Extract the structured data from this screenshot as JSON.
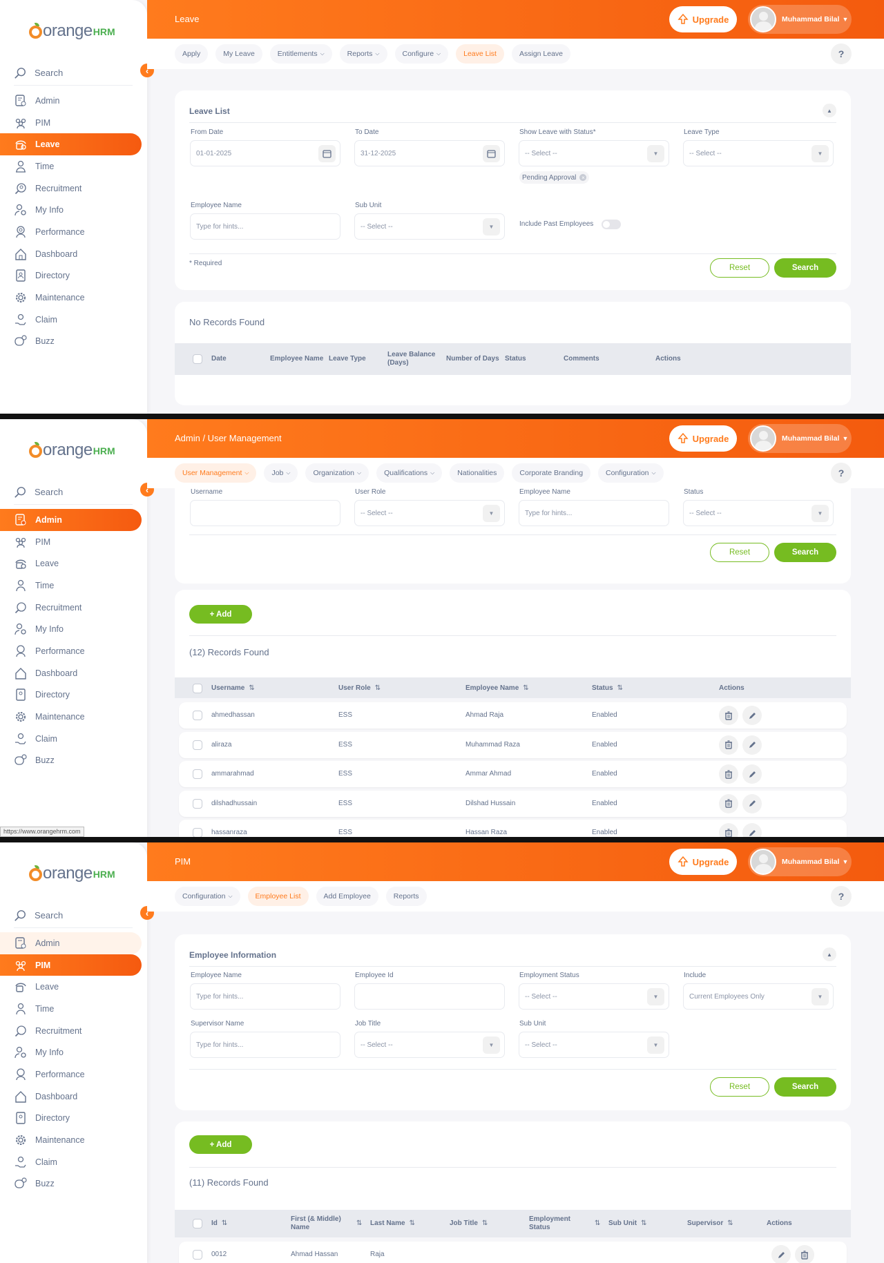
{
  "app": {
    "logo_word": "orange",
    "logo_suffix": "HRM",
    "search_label": "Search",
    "upgrade_label": "Upgrade",
    "user_name": "Muhammad Bilal",
    "help_label": "?"
  },
  "menu": [
    "Admin",
    "PIM",
    "Leave",
    "Time",
    "Recruitment",
    "My Info",
    "Performance",
    "Dashboard",
    "Directory",
    "Maintenance",
    "Claim",
    "Buzz"
  ],
  "colors": {
    "accent": "#ff7b1d",
    "green": "#76bc21",
    "text": "#64728c"
  },
  "screen1": {
    "title": "Leave",
    "tabs": [
      {
        "label": "Apply",
        "dropdown": false
      },
      {
        "label": "My Leave",
        "dropdown": false
      },
      {
        "label": "Entitlements",
        "dropdown": true
      },
      {
        "label": "Reports",
        "dropdown": true
      },
      {
        "label": "Configure",
        "dropdown": true
      },
      {
        "label": "Leave List",
        "dropdown": false,
        "active": true
      },
      {
        "label": "Assign Leave",
        "dropdown": false
      }
    ],
    "filter_title": "Leave List",
    "from_date_label": "From Date",
    "from_date": "01-01-2025",
    "to_date_label": "To Date",
    "to_date": "31-12-2025",
    "status_label": "Show Leave with Status*",
    "status_placeholder": "-- Select --",
    "status_chip": "Pending Approval",
    "leave_type_label": "Leave Type",
    "leave_type_placeholder": "-- Select --",
    "employee_label": "Employee Name",
    "employee_placeholder": "Type for hints...",
    "subunit_label": "Sub Unit",
    "subunit_placeholder": "-- Select --",
    "past_label": "Include Past Employees",
    "required": "* Required",
    "reset": "Reset",
    "search": "Search",
    "no_records": "No Records Found",
    "columns": [
      "Date",
      "Employee Name",
      "Leave Type",
      "Leave Balance (Days)",
      "Number of Days",
      "Status",
      "Comments",
      "Actions"
    ]
  },
  "screen2": {
    "title": "Admin / User Management",
    "tabs": [
      {
        "label": "User Management",
        "dropdown": true,
        "active": true
      },
      {
        "label": "Job",
        "dropdown": true
      },
      {
        "label": "Organization",
        "dropdown": true
      },
      {
        "label": "Qualifications",
        "dropdown": true
      },
      {
        "label": "Nationalities",
        "dropdown": false
      },
      {
        "label": "Corporate Branding",
        "dropdown": false
      },
      {
        "label": "Configuration",
        "dropdown": true
      }
    ],
    "username_label": "Username",
    "role_label": "User Role",
    "role_placeholder": "-- Select --",
    "emp_label": "Employee Name",
    "emp_placeholder": "Type for hints...",
    "status_label": "Status",
    "status_placeholder": "-- Select --",
    "reset": "Reset",
    "search": "Search",
    "add": "+ Add",
    "records": "(12) Records Found",
    "columns": [
      "Username",
      "User Role",
      "Employee Name",
      "Status",
      "Actions"
    ],
    "rows": [
      {
        "username": "ahmedhassan",
        "role": "ESS",
        "employee": "Ahmad Raja",
        "status": "Enabled"
      },
      {
        "username": "aliraza",
        "role": "ESS",
        "employee": "Muhammad Raza",
        "status": "Enabled"
      },
      {
        "username": "ammarahmad",
        "role": "ESS",
        "employee": "Ammar Ahmad",
        "status": "Enabled"
      },
      {
        "username": "dilshadhussain",
        "role": "ESS",
        "employee": "Dilshad Hussain",
        "status": "Enabled"
      },
      {
        "username": "hassanraza",
        "role": "ESS",
        "employee": "Hassan Raza",
        "status": "Enabled"
      }
    ],
    "status_url": "https://www.orangehrm.com"
  },
  "screen3": {
    "title": "PIM",
    "tabs": [
      {
        "label": "Configuration",
        "dropdown": true
      },
      {
        "label": "Employee List",
        "dropdown": false,
        "active": true
      },
      {
        "label": "Add Employee",
        "dropdown": false
      },
      {
        "label": "Reports",
        "dropdown": false
      }
    ],
    "filter_title": "Employee Information",
    "emp_label": "Employee Name",
    "emp_placeholder": "Type for hints...",
    "id_label": "Employee Id",
    "emp_status_label": "Employment Status",
    "emp_status_placeholder": "-- Select --",
    "include_label": "Include",
    "include_value": "Current Employees Only",
    "supervisor_label": "Supervisor Name",
    "supervisor_placeholder": "Type for hints...",
    "job_label": "Job Title",
    "job_placeholder": "-- Select --",
    "subunit_label": "Sub Unit",
    "subunit_placeholder": "-- Select --",
    "reset": "Reset",
    "search": "Search",
    "add": "+ Add",
    "records": "(11) Records Found",
    "columns": [
      "Id",
      "First (& Middle) Name",
      "Last Name",
      "Job Title",
      "Employment Status",
      "Sub Unit",
      "Supervisor",
      "Actions"
    ],
    "rows": [
      {
        "id": "0012",
        "first": "Ahmad Hassan",
        "last": "Raja",
        "job": "",
        "emp_status": "",
        "subunit": "",
        "supervisor": ""
      }
    ]
  }
}
